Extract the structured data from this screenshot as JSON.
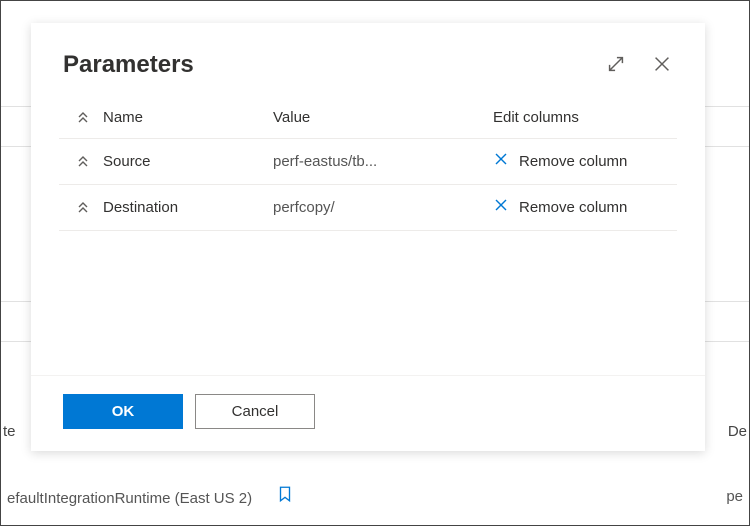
{
  "dialog": {
    "title": "Parameters",
    "headers": {
      "name": "Name",
      "value": "Value",
      "edit": "Edit columns"
    },
    "rows": [
      {
        "name": "Source",
        "value": "perf-eastus/tb...",
        "remove": "Remove column"
      },
      {
        "name": "Destination",
        "value": "perfcopy/",
        "remove": "Remove column"
      }
    ],
    "buttons": {
      "ok": "OK",
      "cancel": "Cancel"
    }
  },
  "background": {
    "left_truncated": "te",
    "right_truncated_1": "De",
    "bottom_text": "efaultIntegrationRuntime (East US 2)",
    "right_truncated_2": "pe"
  }
}
